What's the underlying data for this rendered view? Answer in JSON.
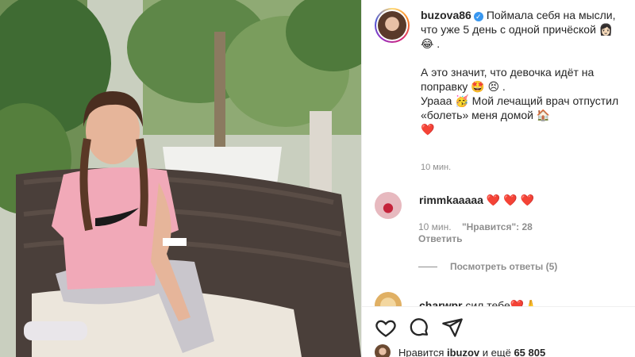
{
  "colors": {
    "text": "#262626",
    "muted": "#8e8e8e",
    "verified": "#3897f0",
    "heart": "#ed4956",
    "border": "#efefef"
  },
  "post": {
    "username": "buzova86",
    "caption_line1": "Поймала себя на мысли, что уже 5 день с одной причёской 👩🏻 😂 .",
    "caption_line2": "А это значит, что девочка идёт на поправку 🤩 😣 .",
    "caption_line3": "Урааа 🥳 Мой лечащий врач отпустил «болеть» меня домой 🏠",
    "caption_heart": "❤️",
    "time": "10 мин."
  },
  "comment": {
    "username": "rimmkaaaaa",
    "text": "❤️ ❤️ ❤️",
    "time": "10 мин.",
    "likes": "\"Нравится\": 28",
    "reply": "Ответить",
    "view_replies": "Посмотреть ответы (5)"
  },
  "comment2": {
    "username": "charwpr",
    "text": "сил тебе❤️🙏"
  },
  "likes": {
    "prefix": "Нравится",
    "user": "ibuzov",
    "suffix": "и ещё",
    "count": "65 805"
  },
  "icons": {
    "like": "heart-outline-icon",
    "comment": "comment-bubble-icon",
    "share": "paper-plane-icon",
    "verified": "verified-badge-icon"
  }
}
